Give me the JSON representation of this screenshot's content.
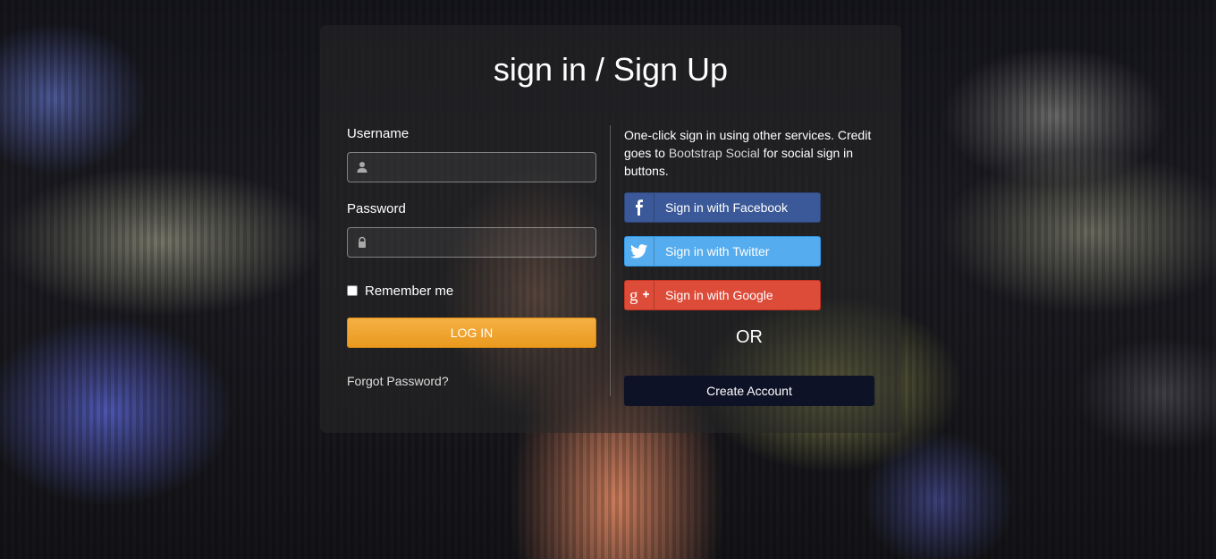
{
  "page": {
    "title": "sign in / Sign Up"
  },
  "login_form": {
    "username_label": "Username",
    "username_icon": "user-icon",
    "username_value": "",
    "password_label": "Password",
    "password_icon": "lock-icon",
    "password_value": "",
    "remember_label": "Remember me",
    "remember_checked": false,
    "login_button": "LOG IN",
    "forgot_link": "Forgot Password?"
  },
  "social": {
    "intro_before": "One-click sign in using other services. Credit goes to ",
    "intro_link": "Bootstrap Social",
    "intro_after": " for social sign in buttons.",
    "buttons": [
      {
        "label": "Sign in with Facebook",
        "icon": "facebook-icon",
        "color": "#3b5998"
      },
      {
        "label": "Sign in with Twitter",
        "icon": "twitter-icon",
        "color": "#55acee"
      },
      {
        "label": "Sign in with Google",
        "icon": "google-plus-icon",
        "color": "#dd4b39"
      }
    ],
    "or_text": "OR",
    "create_account": "Create Account"
  },
  "colors": {
    "login_button": "#f0a22e",
    "create_account_button": "#0d1227"
  }
}
